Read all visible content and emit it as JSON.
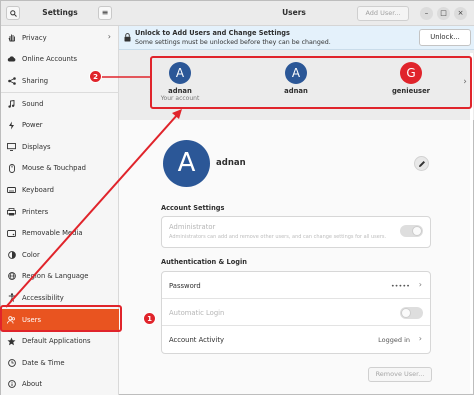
{
  "sidebar": {
    "title": "Settings",
    "items": [
      {
        "label": "Privacy",
        "icon": "hand-icon",
        "chevron": true
      },
      {
        "label": "Online Accounts",
        "icon": "cloud-icon"
      },
      {
        "label": "Sharing",
        "icon": "share-icon"
      },
      {
        "label": "Sound",
        "icon": "music-note-icon"
      },
      {
        "label": "Power",
        "icon": "power-icon"
      },
      {
        "label": "Displays",
        "icon": "monitor-icon"
      },
      {
        "label": "Mouse & Touchpad",
        "icon": "mouse-icon"
      },
      {
        "label": "Keyboard",
        "icon": "keyboard-icon"
      },
      {
        "label": "Printers",
        "icon": "printer-icon"
      },
      {
        "label": "Removable Media",
        "icon": "media-icon"
      },
      {
        "label": "Color",
        "icon": "color-icon"
      },
      {
        "label": "Region & Language",
        "icon": "globe-icon"
      },
      {
        "label": "Accessibility",
        "icon": "accessibility-icon"
      },
      {
        "label": "Users",
        "icon": "users-icon",
        "active": true
      },
      {
        "label": "Default Applications",
        "icon": "star-icon"
      },
      {
        "label": "Date & Time",
        "icon": "clock-icon"
      },
      {
        "label": "About",
        "icon": "info-icon"
      }
    ]
  },
  "header": {
    "title": "Users",
    "add_user": "Add User...",
    "window_controls": [
      "minimize-icon",
      "maximize-icon",
      "close-icon"
    ]
  },
  "unlock": {
    "title": "Unlock to Add Users and Change Settings",
    "subtitle": "Some settings must be unlocked before they can be changed.",
    "button": "Unlock..."
  },
  "carousel": {
    "users": [
      {
        "initial": "A",
        "name": "adnan",
        "sub": "Your account",
        "color": "#2b5797"
      },
      {
        "initial": "A",
        "name": "adnan",
        "sub": "",
        "color": "#2b5797"
      },
      {
        "initial": "G",
        "name": "genieuser",
        "sub": "",
        "color": "#e0242b"
      }
    ]
  },
  "detail": {
    "initial": "A",
    "name": "adnan",
    "account_settings": {
      "heading": "Account Settings",
      "administrator": "Administrator",
      "administrator_desc": "Administrators can add and remove other users, and can change settings for all users."
    },
    "auth": {
      "heading": "Authentication & Login",
      "password_label": "Password",
      "password_value": "•••••",
      "auto_login": "Automatic Login",
      "activity_label": "Account Activity",
      "activity_value": "Logged in"
    },
    "remove_button": "Remove User..."
  },
  "annotations": [
    "1",
    "2"
  ],
  "colors": {
    "accent": "#e95420",
    "annotation": "#e0242b",
    "avatar_blue": "#2b5797"
  }
}
